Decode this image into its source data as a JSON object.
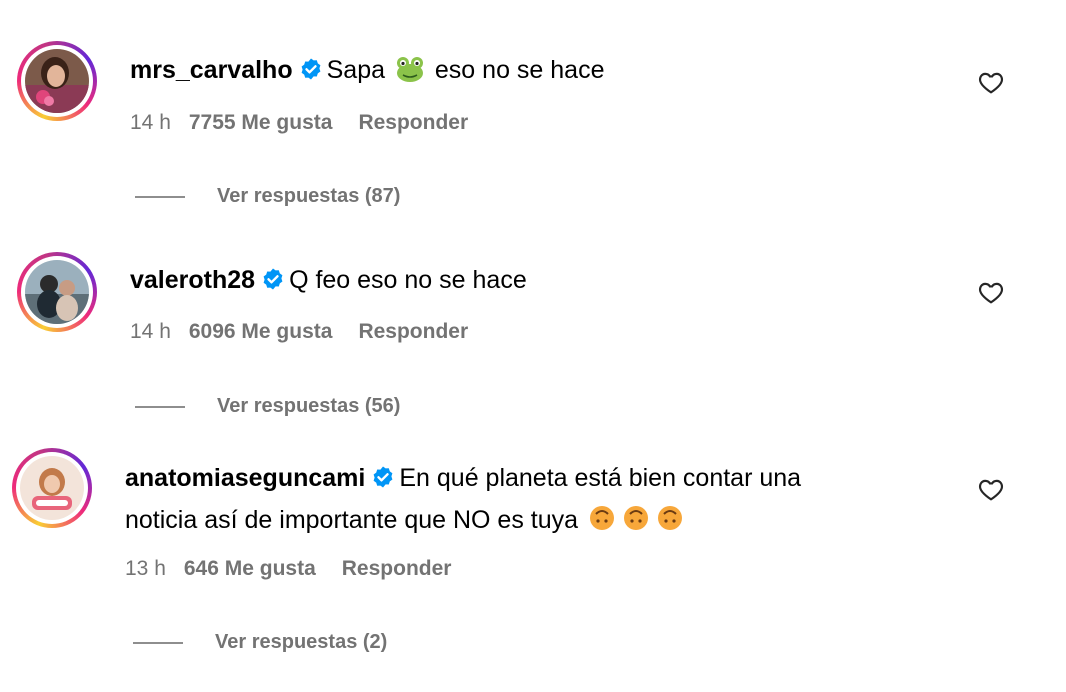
{
  "comments": [
    {
      "username": "mrs_carvalho",
      "text_before_emoji": "Sapa",
      "text_after_emoji": "eso no se hace",
      "emoji": "frog",
      "time": "14 h",
      "likes": "7755 Me gusta",
      "reply": "Responder",
      "view_replies": "Ver respuestas (87)"
    },
    {
      "username": "valeroth28",
      "text": "Q feo eso no se hace",
      "time": "14 h",
      "likes": "6096 Me gusta",
      "reply": "Responder",
      "view_replies": "Ver respuestas (56)"
    },
    {
      "username": "anatomiaseguncami",
      "text_line1": "En qué planeta está bien contar una",
      "text_line2": "noticia así de importante que NO es tuya",
      "emoji": "upside-down-face x3",
      "time": "13 h",
      "likes": "646 Me gusta",
      "reply": "Responder",
      "view_replies": "Ver respuestas (2)"
    }
  ],
  "colors": {
    "verified": "#0095f6",
    "meta_text": "#737373",
    "ring_gradient": [
      "#f9ce34",
      "#ee2a7b",
      "#6228d7"
    ]
  }
}
